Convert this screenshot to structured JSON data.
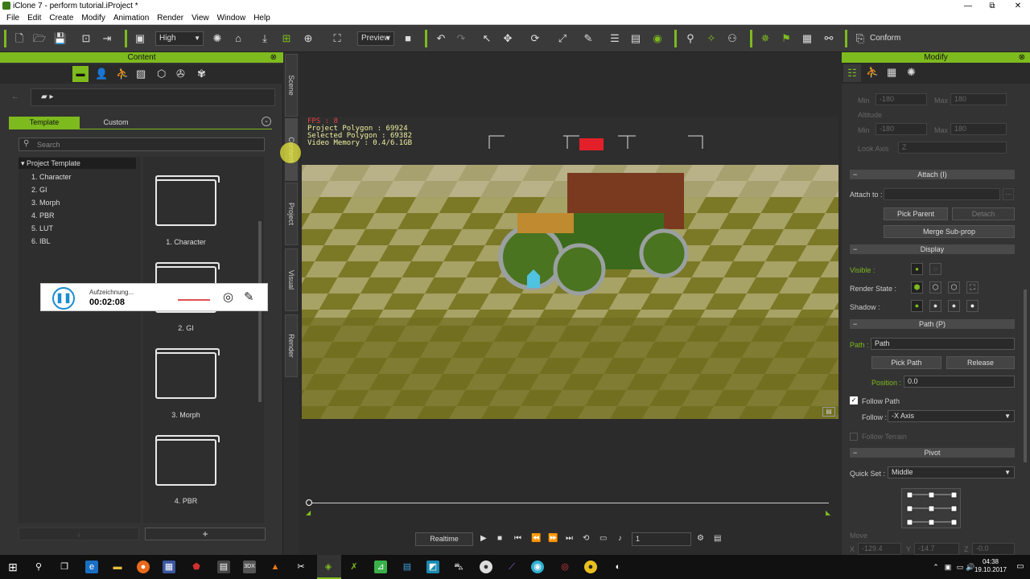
{
  "window": {
    "title": "iClone 7 - perform tutorial.iProject *",
    "minimize": "—",
    "restore": "⧉",
    "close": "✕"
  },
  "menu": [
    "File",
    "Edit",
    "Create",
    "Modify",
    "Animation",
    "Render",
    "View",
    "Window",
    "Help"
  ],
  "toolbar": {
    "quality": "High",
    "preview": "Preview",
    "conform_label": "Conform"
  },
  "content": {
    "title": "Content",
    "tabs": {
      "template": "Template",
      "custom": "Custom"
    },
    "search_placeholder": "Search",
    "tree": {
      "root": "Project Template",
      "items": [
        "1. Character",
        "2. GI",
        "3. Morph",
        "4. PBR",
        "5. LUT",
        "6. IBL"
      ]
    },
    "folders": [
      "1. Character",
      "2. GI",
      "3. Morph",
      "4. PBR"
    ],
    "add_label": "+"
  },
  "recorder": {
    "status": "Aufzeichnung...",
    "time": "00:02:08"
  },
  "side_tabs": [
    "Scene",
    "Content",
    "Project",
    "Visual",
    "Render"
  ],
  "viewport": {
    "stats": [
      "FPS : 8",
      "Project Polygon : 69924",
      "Selected Polygon : 69382",
      "Video Memory : 0.4/6.1GB"
    ]
  },
  "timeline": {
    "mode": "Realtime",
    "frame": "1"
  },
  "modify": {
    "title": "Modify",
    "ghost": {
      "min1": "Min",
      "min1_val": "-180",
      "max1": "Max",
      "max1_val": "180",
      "altitude": "Altitude",
      "min2": "Min",
      "min2_val": "-180",
      "max2": "Max",
      "max2_val": "180",
      "look_axis": "Look Axis",
      "look_axis_val": "Z"
    },
    "attach_section": "Attach (I)",
    "attach_to": "Attach to :",
    "pick_parent": "Pick Parent",
    "detach": "Detach",
    "merge_subprop": "Merge Sub-prop",
    "display_section": "Display",
    "visible": "Visible :",
    "render_state": "Render State :",
    "shadow": "Shadow :",
    "path_section": "Path (P)",
    "path_label": "Path :",
    "path_value": "Path",
    "pick_path": "Pick Path",
    "release": "Release",
    "position_label": "Position :",
    "position_value": "0.0",
    "follow_path": "Follow Path",
    "follow_label": "Follow :",
    "follow_value": "-X Axis",
    "follow_terrain": "Follow Terrain",
    "pivot_section": "Pivot",
    "quick_set_label": "Quick Set :",
    "quick_set_value": "Middle",
    "move_label": "Move",
    "move_x": "X",
    "move_x_val": "-129.4",
    "move_y": "Y",
    "move_y_val": "-14.7",
    "move_z": "Z",
    "move_z_val": "-0.0"
  },
  "taskbar": {
    "time": "04:38",
    "date": "19.10.2017"
  },
  "colors": {
    "accent": "#7dba1e",
    "panel": "#333333",
    "viewport_floor": "#8a8a30"
  }
}
